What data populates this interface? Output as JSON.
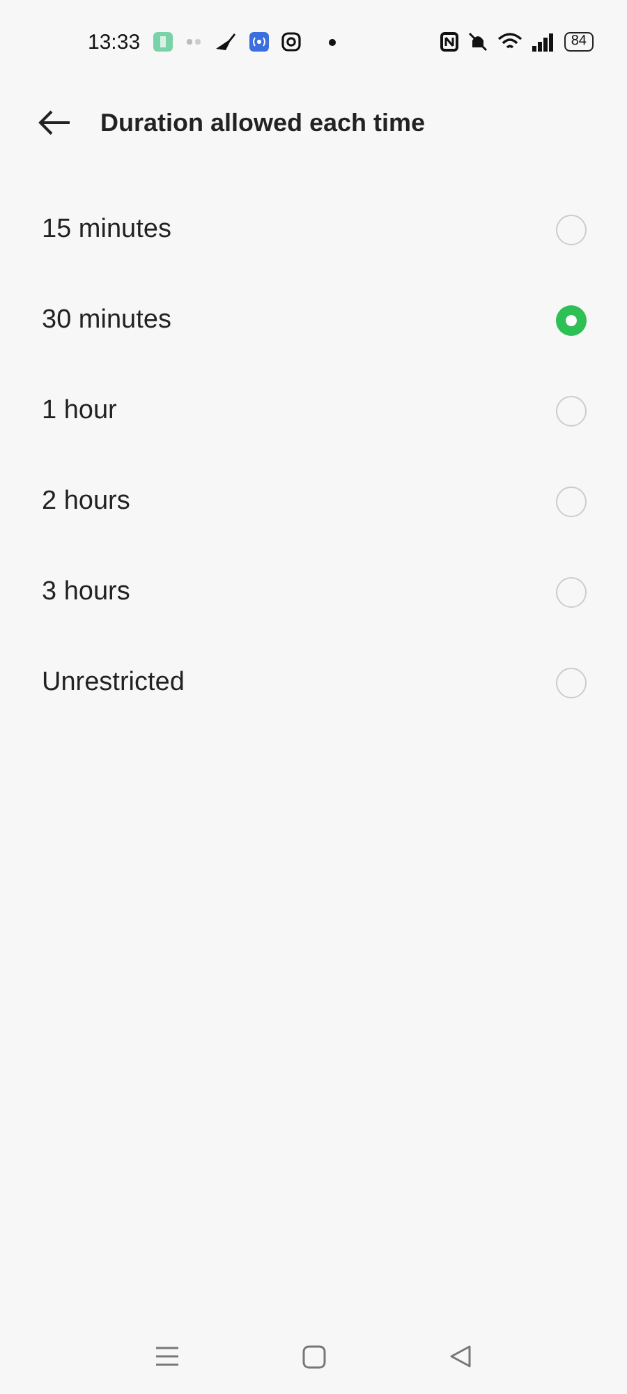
{
  "status_bar": {
    "time": "13:33",
    "battery": "84"
  },
  "header": {
    "title": "Duration allowed each time"
  },
  "options": [
    {
      "label": "15 minutes",
      "selected": false
    },
    {
      "label": "30 minutes",
      "selected": true
    },
    {
      "label": "1 hour",
      "selected": false
    },
    {
      "label": "2 hours",
      "selected": false
    },
    {
      "label": "3 hours",
      "selected": false
    },
    {
      "label": "Unrestricted",
      "selected": false
    }
  ]
}
